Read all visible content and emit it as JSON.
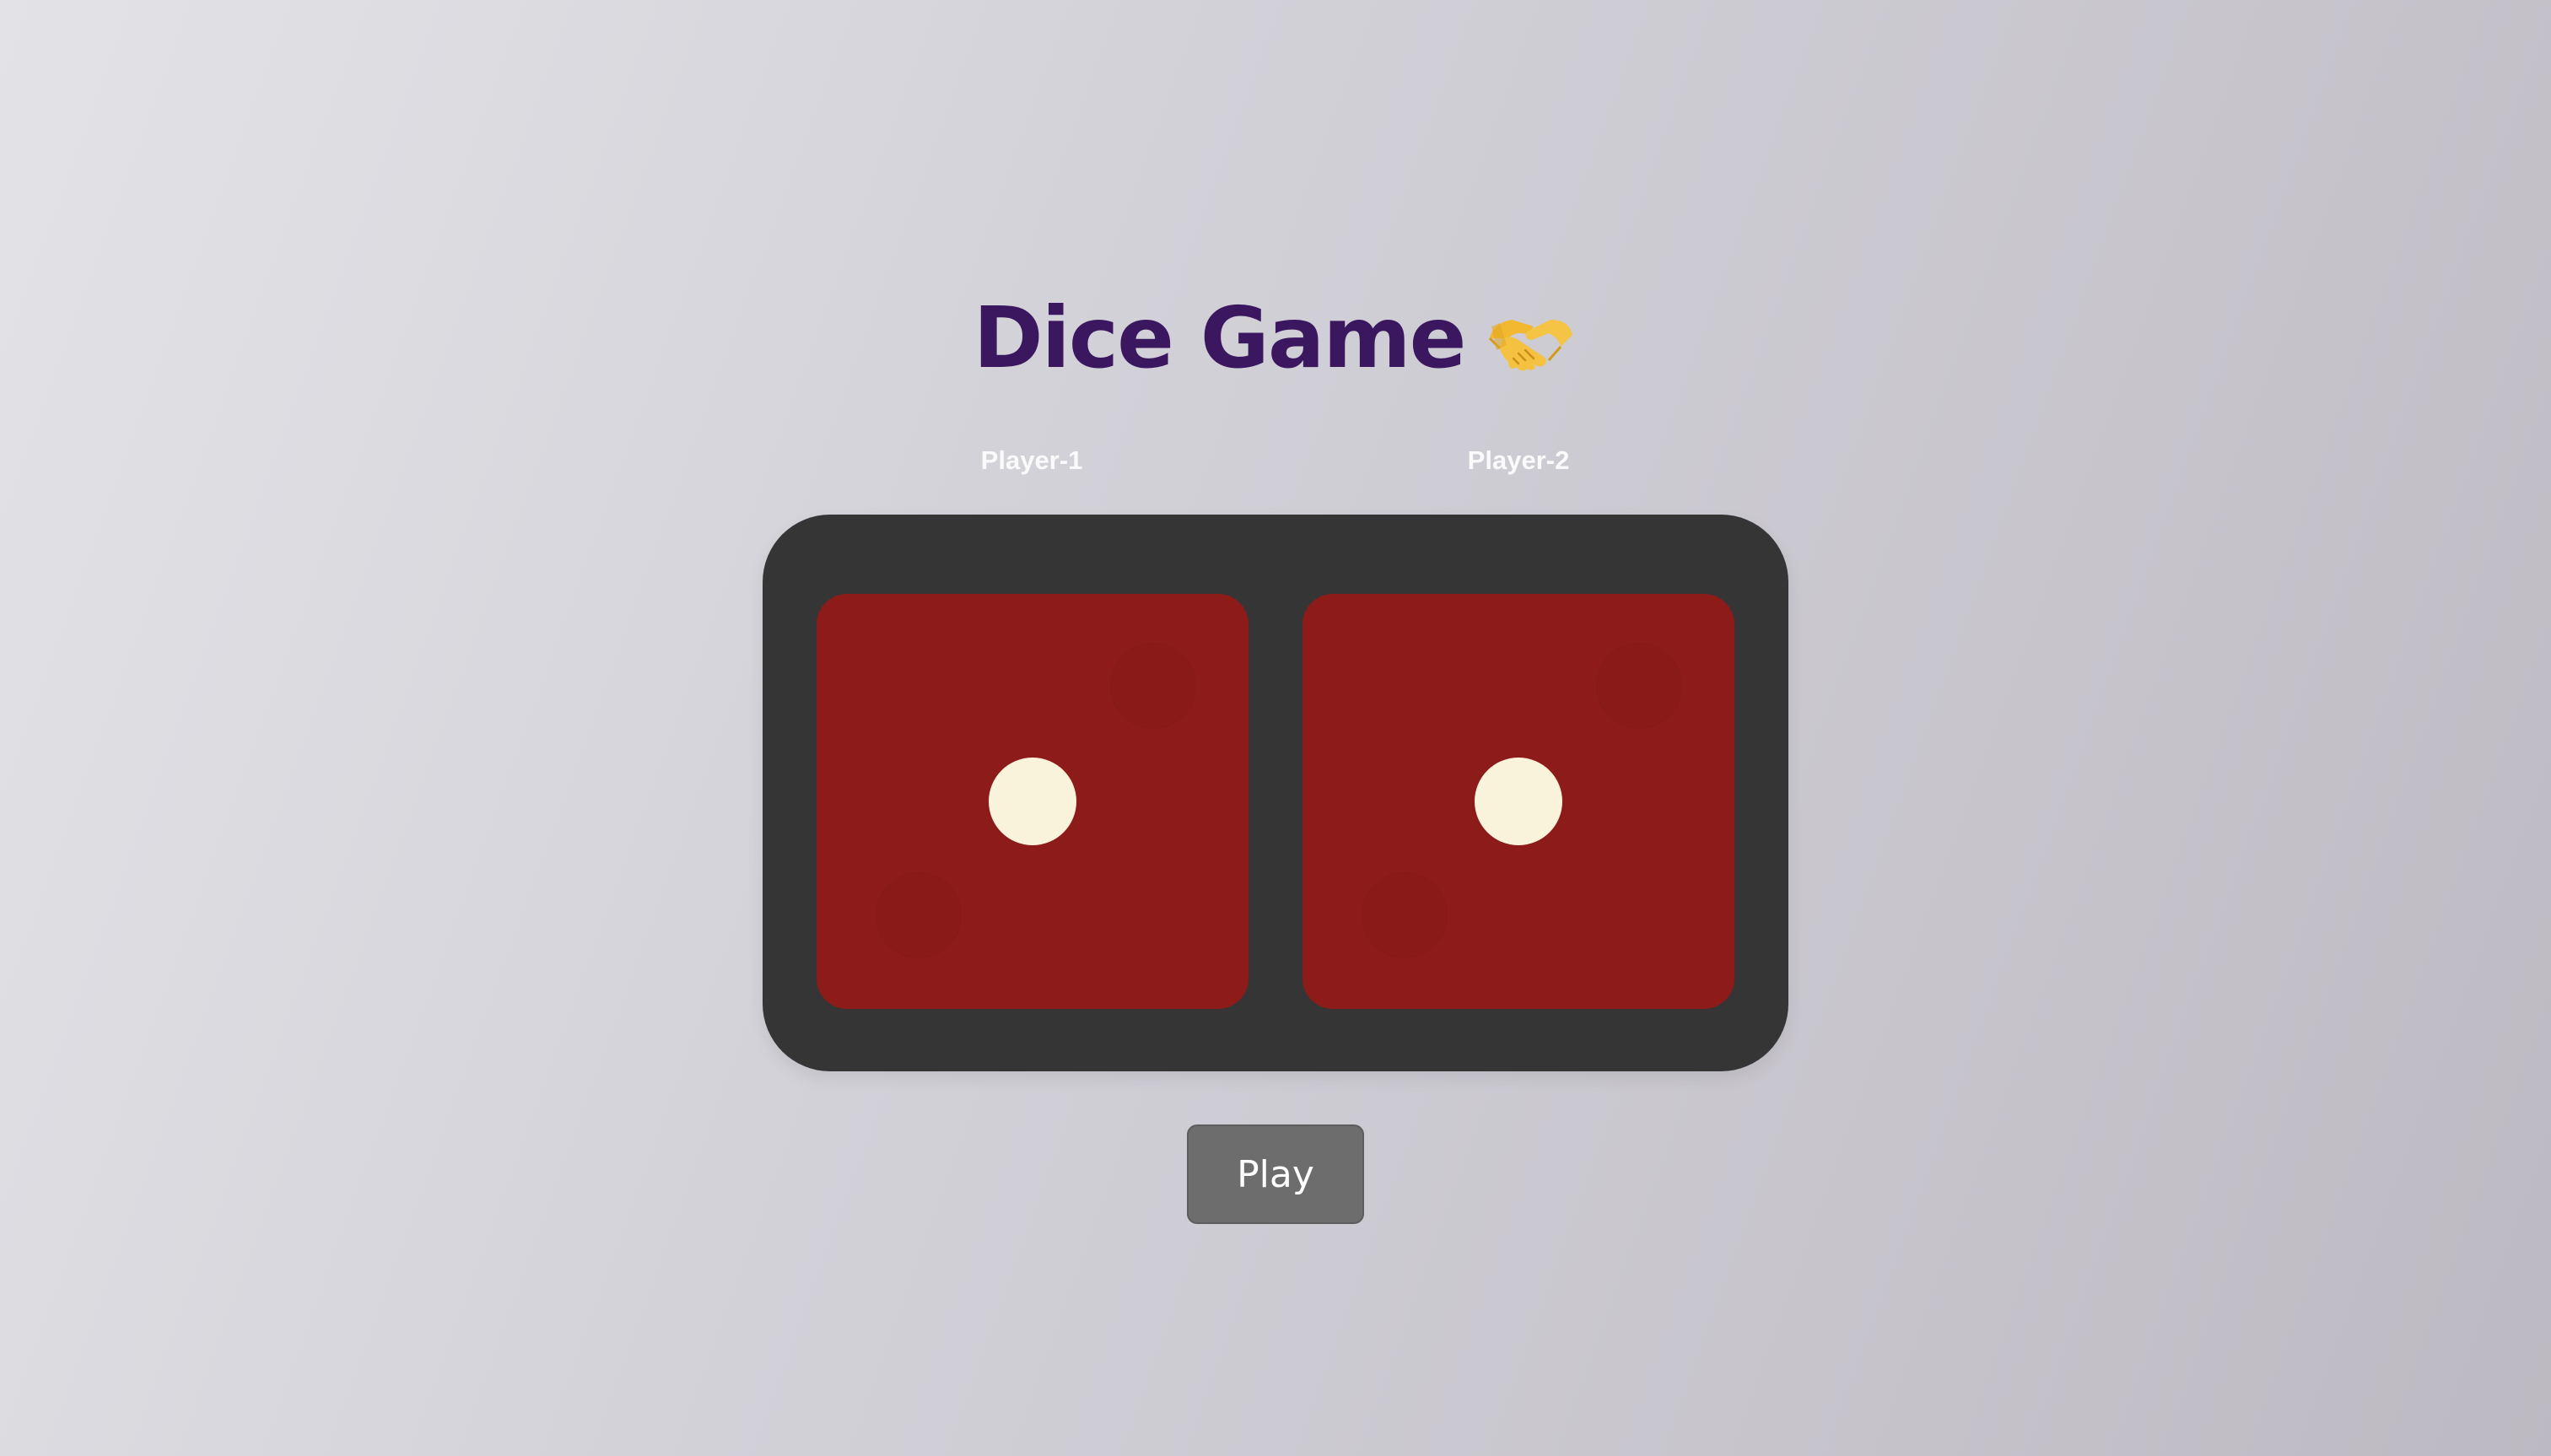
{
  "header": {
    "title": "Dice Game",
    "emoji_icon": "handshake-icon"
  },
  "players": [
    {
      "label": "Player-1",
      "die_value": 1
    },
    {
      "label": "Player-2",
      "die_value": 1
    }
  ],
  "controls": {
    "play_label": "Play"
  },
  "colors": {
    "title": "#3a175f",
    "board": "#353535",
    "die_face": "#8d1b19",
    "pip": "#faf3dc",
    "button": "#6d6d6d",
    "label": "#fafafa"
  }
}
